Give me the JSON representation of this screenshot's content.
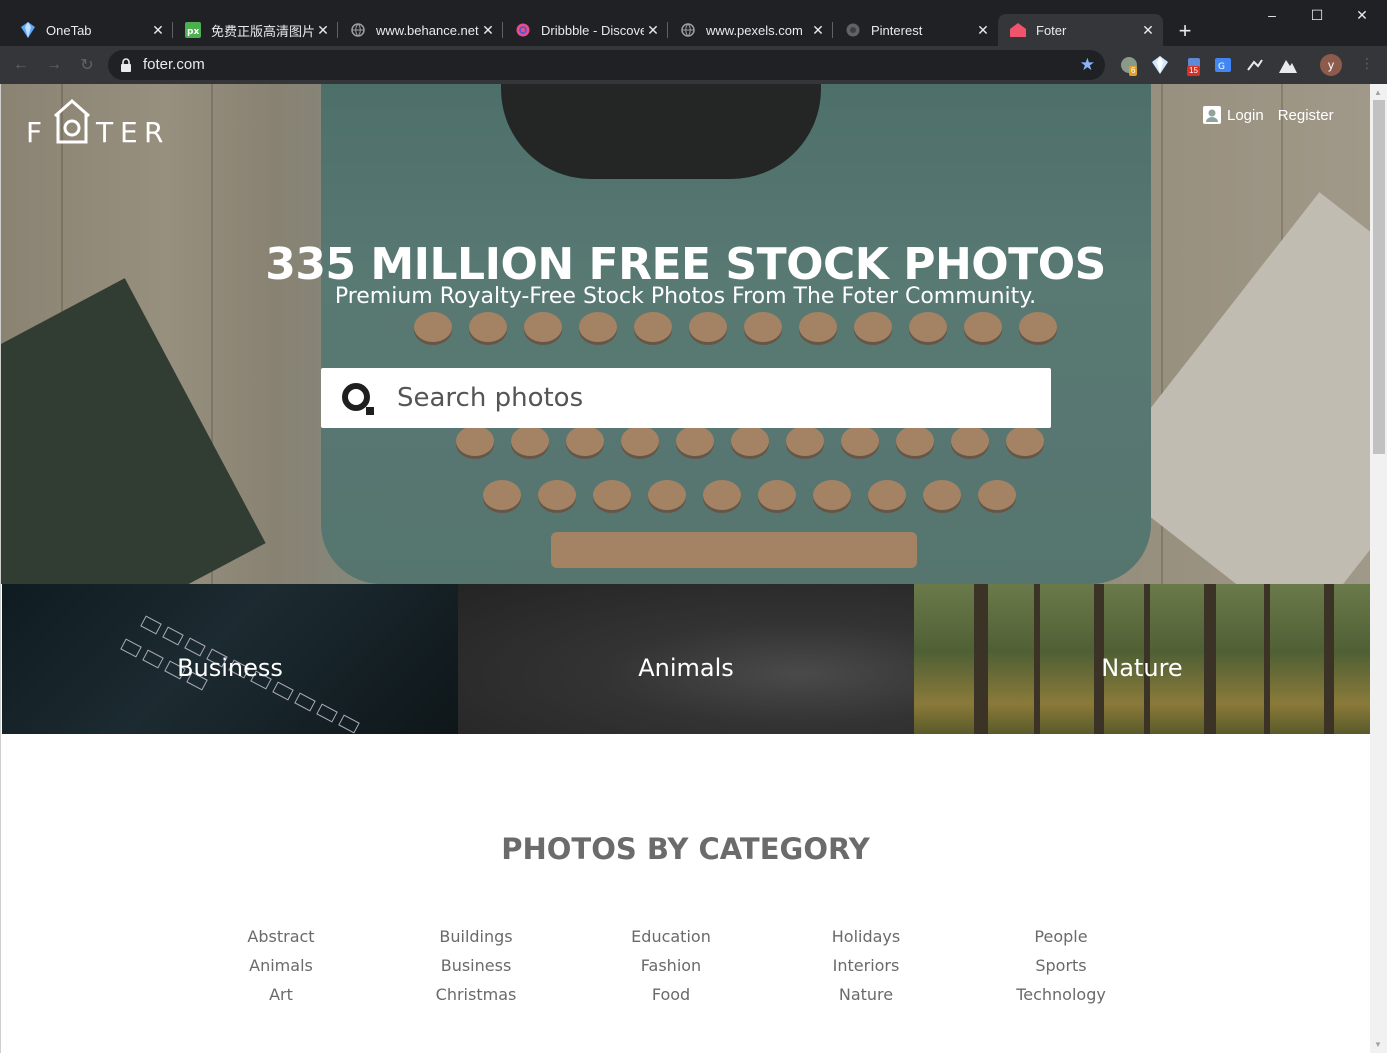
{
  "browser": {
    "tabs": [
      {
        "title": "OneTab",
        "favicon": "onetab-icon"
      },
      {
        "title": "免费正版高清图片素材",
        "favicon": "pexels-px-icon"
      },
      {
        "title": "www.behance.net",
        "favicon": "globe-icon"
      },
      {
        "title": "Dribbble - Discover",
        "favicon": "dribbble-icon"
      },
      {
        "title": "www.pexels.com",
        "favicon": "globe-icon"
      },
      {
        "title": "Pinterest",
        "favicon": "pinterest-icon"
      },
      {
        "title": "Foter",
        "favicon": "foter-house-icon",
        "active": true
      }
    ],
    "url": "foter.com",
    "extensions": {
      "badge_1": "6",
      "badge_2": "15"
    },
    "profile_initial": "y"
  },
  "site": {
    "logo_letters": [
      "F",
      "T",
      "E",
      "R"
    ],
    "login_label": "Login",
    "register_label": "Register",
    "hero_title": "335 MILLION FREE STOCK PHOTOS",
    "hero_subtitle": "Premium Royalty-Free Stock Photos From The Foter Community.",
    "search_placeholder": "Search photos",
    "featured_categories": [
      {
        "label": "Business"
      },
      {
        "label": "Animals"
      },
      {
        "label": "Nature"
      }
    ],
    "section_title": "PHOTOS BY CATEGORY",
    "category_columns": [
      [
        "Abstract",
        "Animals",
        "Art"
      ],
      [
        "Buildings",
        "Business",
        "Christmas"
      ],
      [
        "Education",
        "Fashion",
        "Food"
      ],
      [
        "Holidays",
        "Interiors",
        "Nature"
      ],
      [
        "People",
        "Sports",
        "Technology"
      ]
    ]
  },
  "colors": {
    "chrome_bg": "#202124",
    "toolbar_bg": "#35363a",
    "section_title": "#6b6b6b",
    "category_link": "#6a6a6a",
    "bookmark_star": "#8ab4f8"
  }
}
